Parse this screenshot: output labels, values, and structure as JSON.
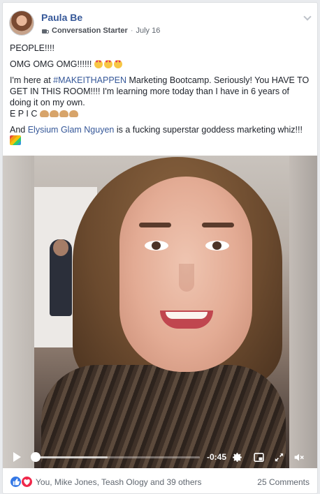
{
  "post": {
    "author": "Paula Be",
    "badge": "Conversation Starter",
    "separator": "·",
    "date": "July 16",
    "lines": {
      "l1": "PEOPLE!!!!",
      "l2": "OMG OMG OMG!!!!!!",
      "l3a": "I'm here at ",
      "l3_tag": "#MAKEITHAPPEN",
      "l3b": " Marketing Bootcamp. Seriously! You HAVE TO GET IN THIS ROOM!!!! I'm learning more today than I have in 6 years of doing it on my own.",
      "l4": "E P I C",
      "l5a": "And ",
      "l5_name": "Elysium Glam Nguyen",
      "l5b": " is a fucking superstar goddess marketing whiz!!!"
    },
    "emoji": {
      "heart_eyes": "smiling-face-with-heart-eyes",
      "clap": "clapping-hands",
      "rainbow": "rainbow"
    }
  },
  "video": {
    "time_remaining": "-0:45",
    "progress": 0.02,
    "buffered": 0.45
  },
  "footer": {
    "reactions": [
      "like",
      "love"
    ],
    "names": "You, Mike Jones, Teash Ology and 39 others",
    "comments": "25 Comments"
  },
  "colors": {
    "link": "#365899",
    "like": "#3578e5",
    "love": "#f0284a"
  }
}
